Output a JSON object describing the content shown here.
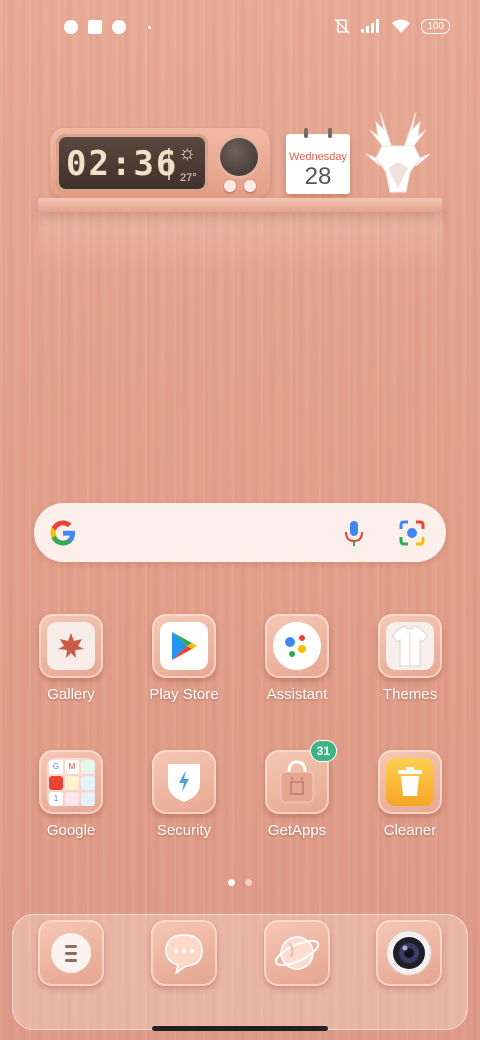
{
  "status_bar": {
    "battery": "100",
    "left_icons": [
      "notification-icon",
      "square-notification-icon",
      "notification-icon-2",
      "dot-icon"
    ],
    "right_icons": [
      "vibrate-off-icon",
      "signal-icon",
      "wifi-icon",
      "battery-icon"
    ]
  },
  "widget": {
    "clock_time": "02:36",
    "weather_temp": "27°",
    "weather_icon": "sun-icon",
    "calendar_day": "Wednesday",
    "calendar_date": "28"
  },
  "search": {
    "icons": [
      "google-logo-icon",
      "mic-icon",
      "lens-icon"
    ]
  },
  "apps_row1": [
    {
      "label": "Gallery",
      "icon": "maple-leaf-icon"
    },
    {
      "label": "Play Store",
      "icon": "play-store-icon"
    },
    {
      "label": "Assistant",
      "icon": "assistant-icon"
    },
    {
      "label": "Themes",
      "icon": "shirt-icon"
    }
  ],
  "apps_row2": [
    {
      "label": "Google",
      "icon": "folder-icon"
    },
    {
      "label": "Security",
      "icon": "shield-bolt-icon"
    },
    {
      "label": "GetApps",
      "icon": "shopping-bag-icon",
      "badge": "31"
    },
    {
      "label": "Cleaner",
      "icon": "trash-icon"
    }
  ],
  "page_indicator": {
    "pages": 2,
    "current": 1
  },
  "dock": [
    {
      "icon": "menu-icon"
    },
    {
      "icon": "messages-icon"
    },
    {
      "icon": "browser-icon"
    },
    {
      "icon": "camera-icon"
    }
  ],
  "colors": {
    "wallpaper": "#e3a08b",
    "badge": "#3db386",
    "calendar_accent": "#e0624c"
  }
}
